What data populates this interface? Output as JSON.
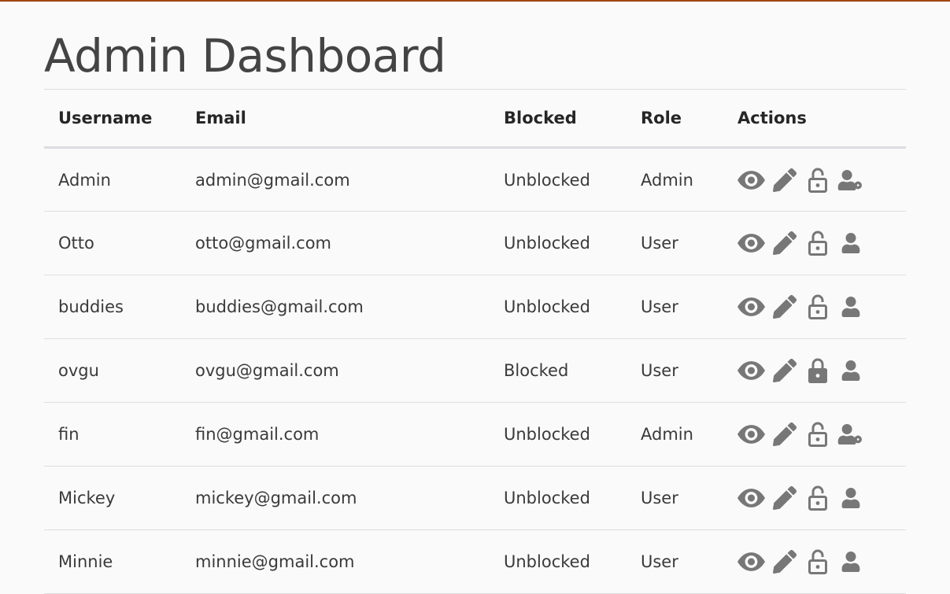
{
  "page": {
    "title": "Admin Dashboard"
  },
  "colors": {
    "accent_top_border": "#a0460a",
    "icon": "#777777",
    "background": "#fafafa"
  },
  "table": {
    "headers": {
      "username": "Username",
      "email": "Email",
      "blocked": "Blocked",
      "role": "Role",
      "actions": "Actions"
    },
    "rows": [
      {
        "username": "Admin",
        "email": "admin@gmail.com",
        "blocked": "Unblocked",
        "role": "Admin",
        "icons": [
          "view-icon",
          "edit-icon",
          "unlocked-icon",
          "user-cog-icon"
        ]
      },
      {
        "username": "Otto",
        "email": "otto@gmail.com",
        "blocked": "Unblocked",
        "role": "User",
        "icons": [
          "view-icon",
          "edit-icon",
          "unlocked-icon",
          "user-icon"
        ]
      },
      {
        "username": "buddies",
        "email": "buddies@gmail.com",
        "blocked": "Unblocked",
        "role": "User",
        "icons": [
          "view-icon",
          "edit-icon",
          "unlocked-icon",
          "user-icon"
        ]
      },
      {
        "username": "ovgu",
        "email": "ovgu@gmail.com",
        "blocked": "Blocked",
        "role": "User",
        "icons": [
          "view-icon",
          "edit-icon",
          "locked-icon",
          "user-icon"
        ]
      },
      {
        "username": "fin",
        "email": "fin@gmail.com",
        "blocked": "Unblocked",
        "role": "Admin",
        "icons": [
          "view-icon",
          "edit-icon",
          "unlocked-icon",
          "user-cog-icon"
        ]
      },
      {
        "username": "Mickey",
        "email": "mickey@gmail.com",
        "blocked": "Unblocked",
        "role": "User",
        "icons": [
          "view-icon",
          "edit-icon",
          "unlocked-icon",
          "user-icon"
        ]
      },
      {
        "username": "Minnie",
        "email": "minnie@gmail.com",
        "blocked": "Unblocked",
        "role": "User",
        "icons": [
          "view-icon",
          "edit-icon",
          "unlocked-icon",
          "user-icon"
        ]
      }
    ]
  }
}
